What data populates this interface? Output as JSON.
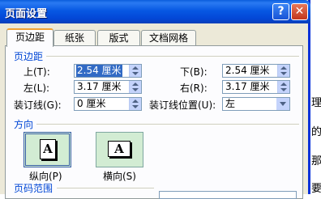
{
  "window": {
    "title": "页面设置",
    "help_glyph": "?",
    "close_glyph": "✕"
  },
  "tabs": [
    {
      "label": "页边距",
      "active": true
    },
    {
      "label": "纸张"
    },
    {
      "label": "版式"
    },
    {
      "label": "文档网格"
    }
  ],
  "margins": {
    "section_label": "页边距",
    "top": {
      "label": "上(T):",
      "value": "2.54 厘米"
    },
    "bottom": {
      "label": "下(B):",
      "value": "2.54 厘米"
    },
    "left": {
      "label": "左(L):",
      "value": "3.17 厘米"
    },
    "right": {
      "label": "右(R):",
      "value": "3.17 厘米"
    },
    "gutter": {
      "label": "装订线(G):",
      "value": "0 厘米"
    },
    "gutter_position": {
      "label": "装订线位置(U):",
      "value": "左"
    }
  },
  "orientation": {
    "section_label": "方向",
    "portrait": {
      "label": "纵向(P)",
      "icon_text": "A",
      "selected": true
    },
    "landscape": {
      "label": "横向(S)",
      "icon_text": "A"
    }
  },
  "pages": {
    "section_label": "页码范围"
  },
  "background_glyphs": [
    "理",
    "的",
    "那",
    "要"
  ],
  "colors": {
    "title_bar": "#0758e3",
    "section_label": "#0046d5",
    "selection": "#316ac5",
    "orientation_bg": "#d2ecd3"
  }
}
